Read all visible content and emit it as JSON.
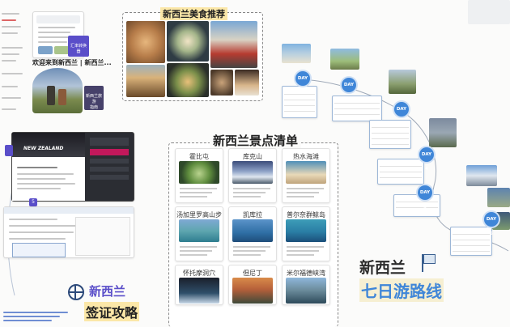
{
  "canvas": {
    "background": "#fbfbfa",
    "accent_blue": "#3f86d8",
    "accent_purple": "#5a4ec9",
    "highlight_yellow": "#fbe7a8"
  },
  "welcome": {
    "title": "欢迎来到新西兰 | 新西兰...",
    "badge1": "汇率转换器",
    "badge2": "新西兰旅游\n指南"
  },
  "food": {
    "title": "新西兰美食推荐"
  },
  "visa": {
    "site_name": "NEW ZEALAND",
    "step_number": "5",
    "title_line1": "新西兰",
    "title_line2": "签证攻略",
    "icon": "globe-icon"
  },
  "sights": {
    "title": "新西兰景点清单",
    "items": [
      {
        "name": "霍比屯"
      },
      {
        "name": "库克山"
      },
      {
        "name": "热水海滩"
      },
      {
        "name": "汤加里罗高山步道"
      },
      {
        "name": "凯库拉"
      },
      {
        "name": "普尔奈群鲸岛"
      },
      {
        "name": "怀托摩洞穴"
      },
      {
        "name": "但尼丁"
      },
      {
        "name": "米尔福德峡湾"
      }
    ]
  },
  "itinerary": {
    "title_line1": "新西兰",
    "title_line2": "七日游路线",
    "icon": "flag-icon",
    "days": [
      "DAY 1",
      "DAY 2",
      "DAY 3",
      "DAY 4",
      "DAY 5",
      "DAY 6"
    ]
  }
}
